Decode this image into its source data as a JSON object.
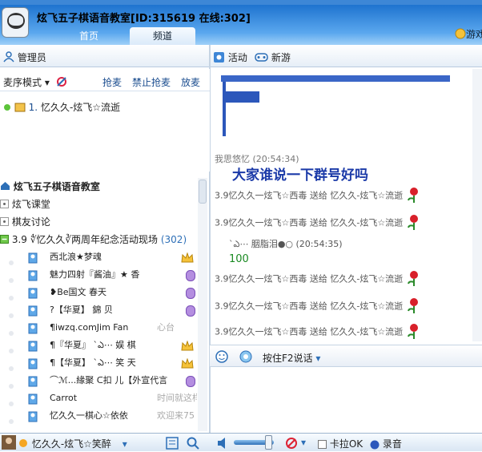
{
  "header": {
    "room_title": "炫飞五子棋语音教室[ID:315619 在线:302]",
    "tabs": [
      "首页",
      "频道"
    ],
    "game_label": "游戏"
  },
  "left_toolbar": {
    "label": "管理员"
  },
  "right_toolbar": {
    "activity": "活动",
    "newgame": "新游"
  },
  "mic": {
    "mode": "麦序模式",
    "links": [
      "抢麦",
      "禁止抢麦",
      "放麦"
    ],
    "queue": [
      {
        "index": "1.",
        "name": "忆久久-炫飞☆流逝"
      }
    ]
  },
  "tree": {
    "root": "炫飞五子棋语音教室",
    "groups": [
      "炫飞课堂",
      "棋友讨论"
    ],
    "active_channel": "3.9 ∜忆久久∛两周年纪念活动现场",
    "active_count": "(302)",
    "members": [
      {
        "name": "西北浪★梦魂",
        "note": ""
      },
      {
        "name": "魅力四射『酱油』★ 香",
        "note": ""
      },
      {
        "name": "❥Be国文  春天",
        "note": ""
      },
      {
        "name": "?【华夏】   錦  贝",
        "note": ""
      },
      {
        "name": "¶iwzq.comJim Fan",
        "note": "心台"
      },
      {
        "name": "¶『华夏』   `ఎ⋯ 娱 棋",
        "note": ""
      },
      {
        "name": "¶【华夏】   `ఎ⋯ 笑 天",
        "note": ""
      },
      {
        "name": "⌒ℳ...緣聚 ᑕ扣 儿【外宣代言",
        "note": ""
      },
      {
        "name": "Carrot",
        "note": "时间就这样在流逝"
      },
      {
        "name": "忆久久一棋心☆依依",
        "note": "欢迎来75"
      }
    ]
  },
  "chat": {
    "partial_name": "我思悠忆",
    "partial_time": "(20:54:34)",
    "big_message": "大家谁说一下群号好吗",
    "gift_message": "3.9忆久久一炫飞☆西毒 送给 忆久久-炫飞☆流逝",
    "user2": "`ఎ⋯ 胭脂泪●○",
    "user2_time": "(20:54:35)",
    "number_message": "100"
  },
  "input_bar": {
    "hint": "按住F2说话"
  },
  "status": {
    "user": "忆久久-炫飞☆笑醉",
    "karaoke": "卡拉OK",
    "record": "录音"
  }
}
